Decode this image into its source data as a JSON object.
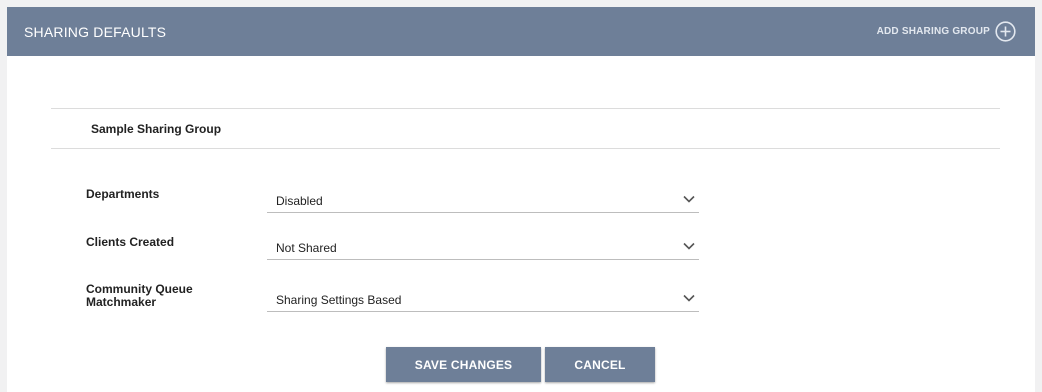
{
  "header": {
    "title": "SHARING DEFAULTS",
    "add_group_label": "ADD SHARING GROUP",
    "add_icon": "plus-circle-icon"
  },
  "group": {
    "name": "Sample Sharing Group"
  },
  "fields": [
    {
      "label": "Departments",
      "value": "Disabled"
    },
    {
      "label": "Clients Created",
      "value": "Not Shared"
    },
    {
      "label": "Community Queue Matchmaker",
      "value": "Sharing Settings Based"
    }
  ],
  "actions": {
    "save_label": "SAVE CHANGES",
    "cancel_label": "CANCEL"
  },
  "colors": {
    "header_bg": "#6e7f98",
    "button_bg": "#6e7f98",
    "page_bg": "#f1f1f2"
  }
}
